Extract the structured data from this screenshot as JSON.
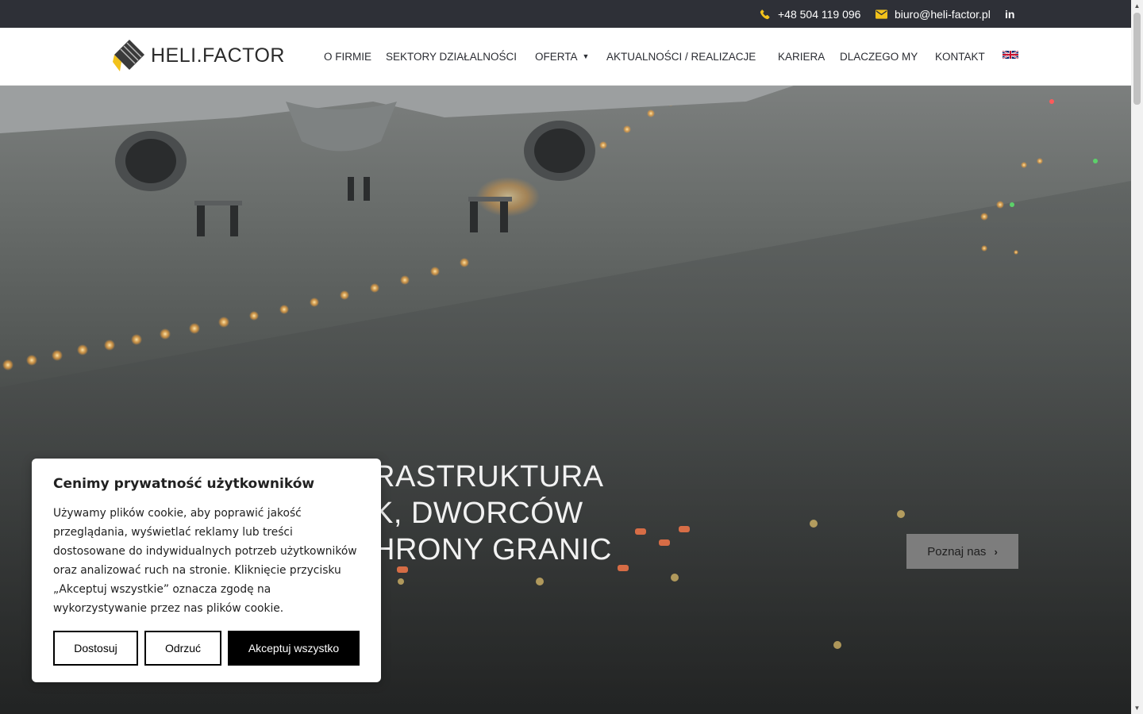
{
  "topbar": {
    "phone": "+48 504 119 096",
    "email": "biuro@heli-factor.pl",
    "linkedin_label": "in"
  },
  "header": {
    "logo_text": "HELI.FACTOR",
    "nav": [
      {
        "label": "O FIRMIE"
      },
      {
        "label": "SEKTORY DZIAŁALNOŚCI"
      },
      {
        "label": "OFERTA",
        "has_dropdown": true
      },
      {
        "label": "AKTUALNOŚCI / REALIZACJE"
      },
      {
        "label": "KARIERA"
      },
      {
        "label": "DLACZEGO MY"
      },
      {
        "label": "KONTAKT"
      }
    ],
    "language_flag": "uk-flag-icon"
  },
  "hero": {
    "title_lines": [
      "RASTRUKTURA",
      "K, DWORCÓW",
      "HRONY GRANIC"
    ],
    "button_label": "Poznaj nas"
  },
  "cookie": {
    "title": "Cenimy prywatność użytkowników",
    "text": "Używamy plików cookie, aby poprawić jakość przeglądania, wyświetlać reklamy lub treści dostosowane do indywidualnych potrzeb użytkowników oraz analizować ruch na stronie. Kliknięcie przycisku „Akceptuj wszystkie” oznacza zgodę na wykorzystywanie przez nas plików cookie.",
    "customize_label": "Dostosuj",
    "reject_label": "Odrzuć",
    "accept_label": "Akceptuj wszystko"
  },
  "colors": {
    "topbar_bg": "#2e3037",
    "icon_accent": "#f2c21b",
    "accept_bg": "#000000"
  }
}
